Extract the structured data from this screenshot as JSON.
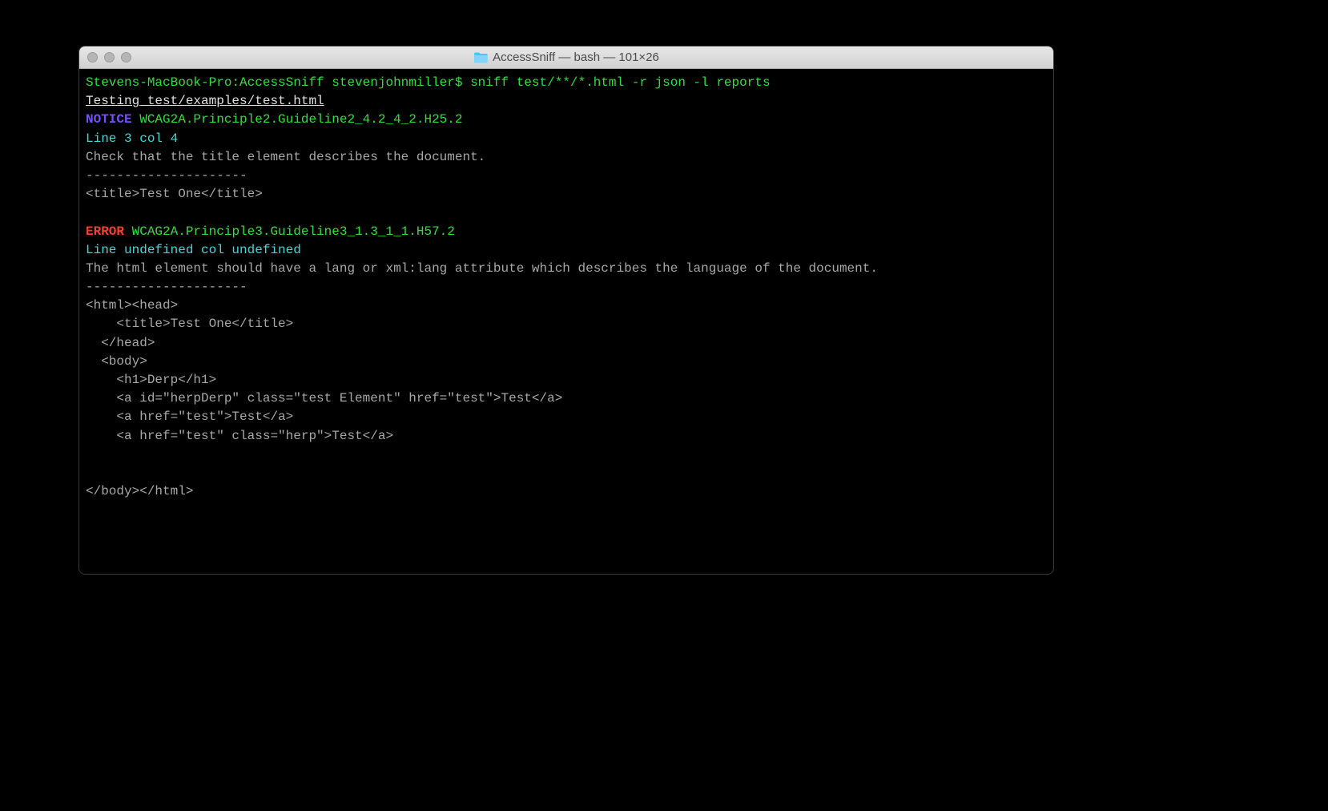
{
  "window": {
    "title": "AccessSniff — bash — 101×26"
  },
  "terminal": {
    "prompt_host": "Stevens-MacBook-Pro:AccessSniff stevenjohnmiller$ ",
    "prompt_cmd": "sniff test/**/*.html -r json -l reports",
    "testing_line": "Testing test/examples/test.html",
    "blank": "",
    "entries": [
      {
        "level_label": "NOTICE",
        "level_class": "c-purple",
        "rule": " WCAG2A.Principle2.Guideline2_4.2_4_2.H25.2",
        "location": "Line 3 col 4",
        "message": "Check that the title element describes the document.",
        "divider": "---------------------",
        "code_lines": [
          "<title>Test One</title>"
        ]
      },
      {
        "level_label": "ERROR",
        "level_class": "c-red",
        "rule": " WCAG2A.Principle3.Guideline3_1.3_1_1.H57.2",
        "location": "Line undefined col undefined",
        "message": "The html element should have a lang or xml:lang attribute which describes the language of the document.",
        "divider": "---------------------",
        "code_lines": [
          "<html><head>",
          "    <title>Test One</title>",
          "  </head>",
          "  <body>",
          "    <h1>Derp</h1>",
          "    <a id=\"herpDerp\" class=\"test Element\" href=\"test\">Test</a>",
          "    <a href=\"test\">Test</a>",
          "    <a href=\"test\" class=\"herp\">Test</a>",
          "  ",
          "",
          "</body></html>"
        ]
      }
    ]
  }
}
